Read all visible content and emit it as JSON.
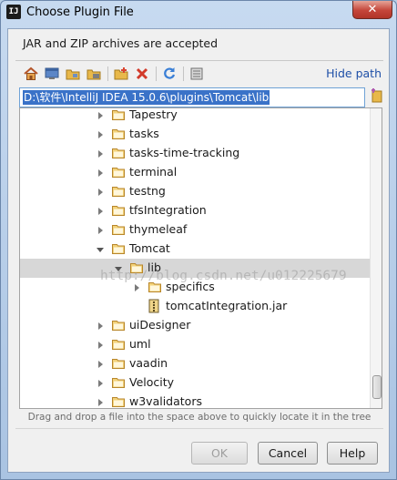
{
  "window": {
    "title": "Choose Plugin File",
    "app_icon_text": "IJ",
    "close_glyph": "✕"
  },
  "subtitle": "JAR and ZIP archives are accepted",
  "toolbar": {
    "icons": [
      "home-icon",
      "desktop-icon",
      "project-icon",
      "module-icon",
      "new-folder-icon",
      "delete-icon",
      "refresh-icon",
      "show-hidden-icon"
    ],
    "hide_path_label": "Hide path"
  },
  "path": {
    "value": "D:\\软件\\IntelliJ IDEA 15.0.6\\plugins\\Tomcat\\lib"
  },
  "tree": {
    "rows": [
      {
        "label": "Tapestry",
        "expanded": false,
        "kind": "folder"
      },
      {
        "label": "tasks",
        "expanded": false,
        "kind": "folder"
      },
      {
        "label": "tasks-time-tracking",
        "expanded": false,
        "kind": "folder"
      },
      {
        "label": "terminal",
        "expanded": false,
        "kind": "folder"
      },
      {
        "label": "testng",
        "expanded": false,
        "kind": "folder"
      },
      {
        "label": "tfsIntegration",
        "expanded": false,
        "kind": "folder"
      },
      {
        "label": "thymeleaf",
        "expanded": false,
        "kind": "folder"
      },
      {
        "label": "Tomcat",
        "expanded": true,
        "kind": "folder"
      },
      {
        "label": "lib",
        "expanded": true,
        "kind": "folder",
        "selected": true
      },
      {
        "label": "specifics",
        "expanded": false,
        "kind": "folder"
      },
      {
        "label": "tomcatIntegration.jar",
        "kind": "jar"
      },
      {
        "label": "uiDesigner",
        "expanded": false,
        "kind": "folder"
      },
      {
        "label": "uml",
        "expanded": false,
        "kind": "folder"
      },
      {
        "label": "vaadin",
        "expanded": false,
        "kind": "folder"
      },
      {
        "label": "Velocity",
        "expanded": false,
        "kind": "folder"
      },
      {
        "label": "w3validators",
        "expanded": false,
        "kind": "folder"
      }
    ]
  },
  "watermark": "http://blog.csdn.net/u012225679",
  "hint": "Drag and drop a file into the space above to quickly locate it in the tree",
  "buttons": {
    "ok": "OK",
    "cancel": "Cancel",
    "help": "Help"
  },
  "colors": {
    "accent": "#3a72c8",
    "link": "#1e4fa7",
    "selected_row": "#d7d7d7",
    "folder": "#e8b84a"
  }
}
